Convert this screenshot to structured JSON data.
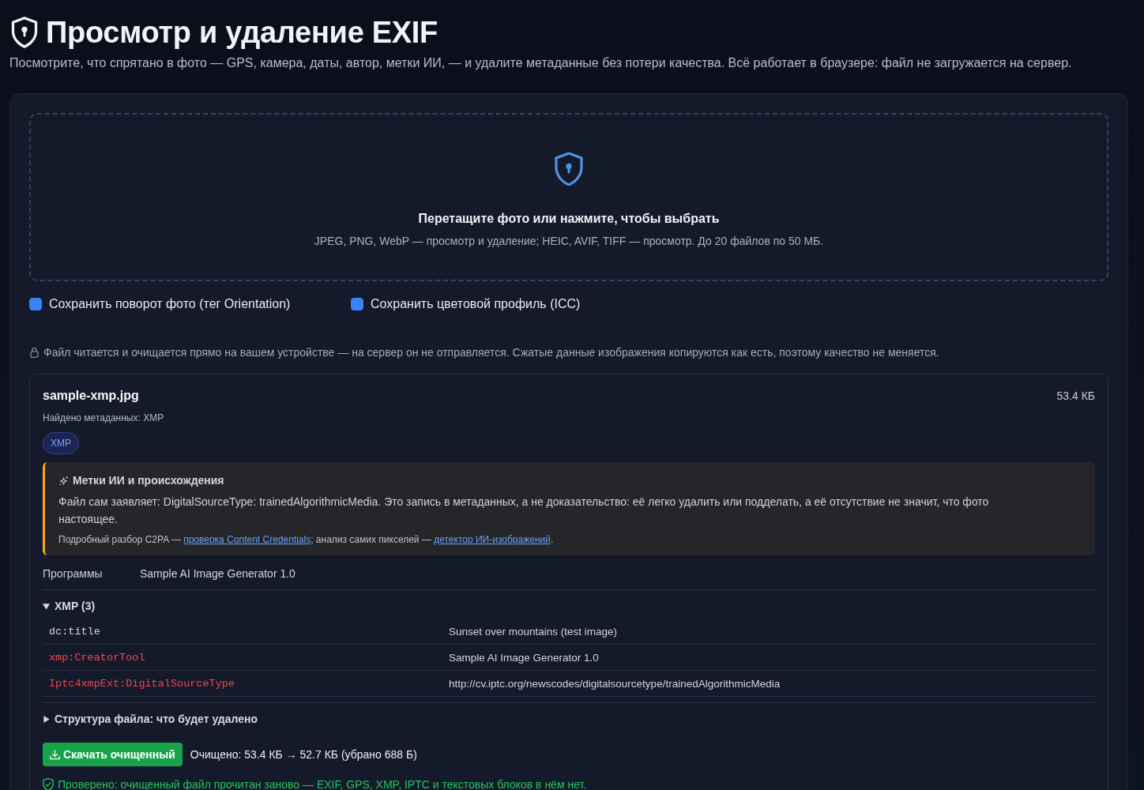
{
  "header": {
    "title": "Просмотр и удаление EXIF",
    "subtitle": "Посмотрите, что спрятано в фото — GPS, камера, даты, автор, метки ИИ, — и удалите метаданные без потери качества. Всё работает в браузере: файл не загружается на сервер."
  },
  "dropzone": {
    "title": "Перетащите фото или нажмите, чтобы выбрать",
    "hint": "JPEG, PNG, WebP — просмотр и удаление; HEIC, AVIF, TIFF — просмотр. До 20 файлов по 50 МБ."
  },
  "options": [
    {
      "label": "Сохранить поворот фото (тег Orientation)",
      "checked": true
    },
    {
      "label": "Сохранить цветовой профиль (ICC)",
      "checked": true
    }
  ],
  "privacy_note": "Файл читается и очищается прямо на вашем устройстве — на сервер он не отправляется. Сжатые данные изображения копируются как есть, поэтому качество не меняется.",
  "file": {
    "name": "sample-xmp.jpg",
    "size": "53.4 КБ",
    "found": "Найдено метаданных: XMP",
    "badges": [
      "XMP"
    ],
    "ai_notice": {
      "title": "Метки ИИ и происхождения",
      "text": "Файл сам заявляет: DigitalSourceType: trainedAlgorithmicMedia. Это запись в метаданных, а не доказательство: её легко удалить или подделать, а её отсутствие не значит, что фото настоящее.",
      "links_line": [
        {
          "kind": "text",
          "text": "Подробный разбор C2PA — "
        },
        {
          "kind": "link",
          "text": "проверка Content Credentials"
        },
        {
          "kind": "text",
          "text": "; анализ самих пикселей — "
        },
        {
          "kind": "link",
          "text": "детектор ИИ-изображений"
        },
        {
          "kind": "text",
          "text": "."
        }
      ]
    },
    "fields": [
      {
        "label": "Программы",
        "value": "Sample AI Image Generator 1.0"
      }
    ],
    "sections": [
      {
        "title": "XMP (3)",
        "expanded": true,
        "rows": [
          {
            "key": "dc:title",
            "value": "Sunset over mountains (test image)",
            "flagged": false
          },
          {
            "key": "xmp:CreatorTool",
            "value": "Sample AI Image Generator 1.0",
            "flagged": true
          },
          {
            "key": "Iptc4xmpExt:DigitalSourceType",
            "value": "http://cv.iptc.org/newscodes/digitalsourcetype/trainedAlgorithmicMedia",
            "flagged": true
          }
        ]
      },
      {
        "title": "Структура файла: что будет удалено",
        "expanded": false
      }
    ],
    "download_button": "Скачать очищенный",
    "result": "Очищено: 53.4 КБ → 52.7 КБ (убрано 688 Б)",
    "verified": "Проверено: очищенный файл прочитан заново — EXIF, GPS, XMP, IPTC и текстовых блоков в нём нет."
  }
}
